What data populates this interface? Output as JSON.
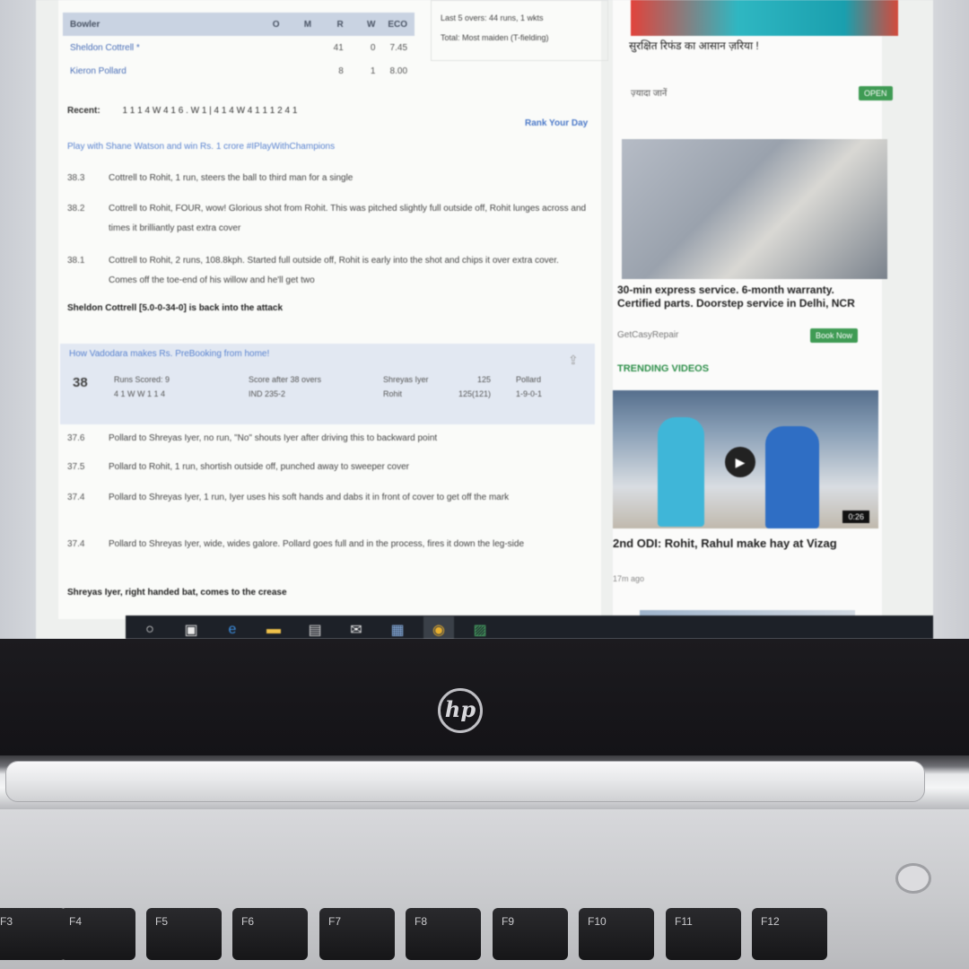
{
  "scorecard": {
    "header": [
      "Bowler",
      "O",
      "M",
      "R",
      "W",
      "ECO"
    ],
    "rows": [
      {
        "name": "Sheldon Cottrell *",
        "o": "",
        "m": "",
        "r": "41",
        "w": "0",
        "eco": "7.45"
      },
      {
        "name": "Kieron Pollard",
        "o": "",
        "m": "",
        "r": "8",
        "w": "1",
        "eco": "8.00"
      }
    ]
  },
  "partnership": {
    "last_wkt": "Last 5 overs: 44 runs, 1 wkts",
    "fow": "Total: Most maiden (T-fielding)"
  },
  "recent": {
    "label": "Recent:",
    "balls": "1 1 1 4 W 4 1 6 . W 1 | 4 1 4 W 4 1 1 1 2 4 1"
  },
  "view_link": "Rank Your Day",
  "promo_link": "Play with Shane Watson and win Rs. 1 crore #IPlayWithChampions",
  "commentary": [
    {
      "over": "38.3",
      "text": "Cottrell to Rohit, 1 run, steers the ball to third man for a single"
    },
    {
      "over": "38.2",
      "text": "Cottrell to Rohit, FOUR, wow! Glorious shot from Rohit. This was pitched slightly full outside off, Rohit lunges across and times it brilliantly past extra cover"
    },
    {
      "over": "38.1",
      "text": "Cottrell to Rohit, 2 runs, 108.8kph. Started full outside off, Rohit is early into the shot and chips it over extra cover. Comes off the toe-end of his willow and he'll get two"
    }
  ],
  "bowler_note": "Sheldon Cottrell [5.0-0-34-0] is back into the attack",
  "over_summary": {
    "link": "How Vadodara makes Rs. PreBooking from home!",
    "over": "38",
    "runs_label": "Runs Scored: 9",
    "runs_balls": "4 1 W W 1 1 4",
    "score_label": "Score after 38 overs",
    "score": "IND 235-2",
    "bat1": "Shreyas Iyer",
    "bat1_score": "125",
    "bat2": "Rohit",
    "bat2_score": "125(121)",
    "bowler": "Pollard",
    "bowler_fig": "1-9-0-1"
  },
  "commentary2": [
    {
      "over": "37.6",
      "text": "Pollard to Shreyas Iyer, no run, \"No\" shouts Iyer after driving this to backward point"
    },
    {
      "over": "37.5",
      "text": "Pollard to Rohit, 1 run, shortish outside off, punched away to sweeper cover"
    },
    {
      "over": "37.4",
      "text": "Pollard to Shreyas Iyer, 1 run, Iyer uses his soft hands and dabs it in front of cover to get off the mark"
    },
    {
      "over": "37.4",
      "text": "Pollard to Shreyas Iyer, wide, wides galore. Pollard goes full and in the process, fires it down the leg-side"
    }
  ],
  "batsman_note": "Shreyas Iyer, right handed bat, comes to the crease",
  "right": {
    "hindi_line": "सुरक्षित रिफंड का आसान ज़रिया !",
    "ad_small": "ज़्यादा जानें",
    "ad_btn": "OPEN",
    "ad_title": "30-min express service. 6-month warranty. Certified parts. Doorstep service in Delhi, NCR",
    "ad_source": "GetCasyRepair",
    "ad_cta": "Book Now",
    "trending": "TRENDING VIDEOS",
    "video_duration": "0:26",
    "video_title": "2nd ODI: Rohit, Rahul make hay at Vizag",
    "video_time": "17m ago"
  },
  "device": {
    "logo": "hp",
    "keys": [
      "F3",
      "F4",
      "F5",
      "F6",
      "F7",
      "F8",
      "F9",
      "F10",
      "F11",
      "F12"
    ]
  },
  "colors": {
    "accent_blue": "#4a78c8",
    "trending_green": "#2e8f4a",
    "table_head": "#c9d3e2",
    "taskbar": "#1d2128"
  }
}
